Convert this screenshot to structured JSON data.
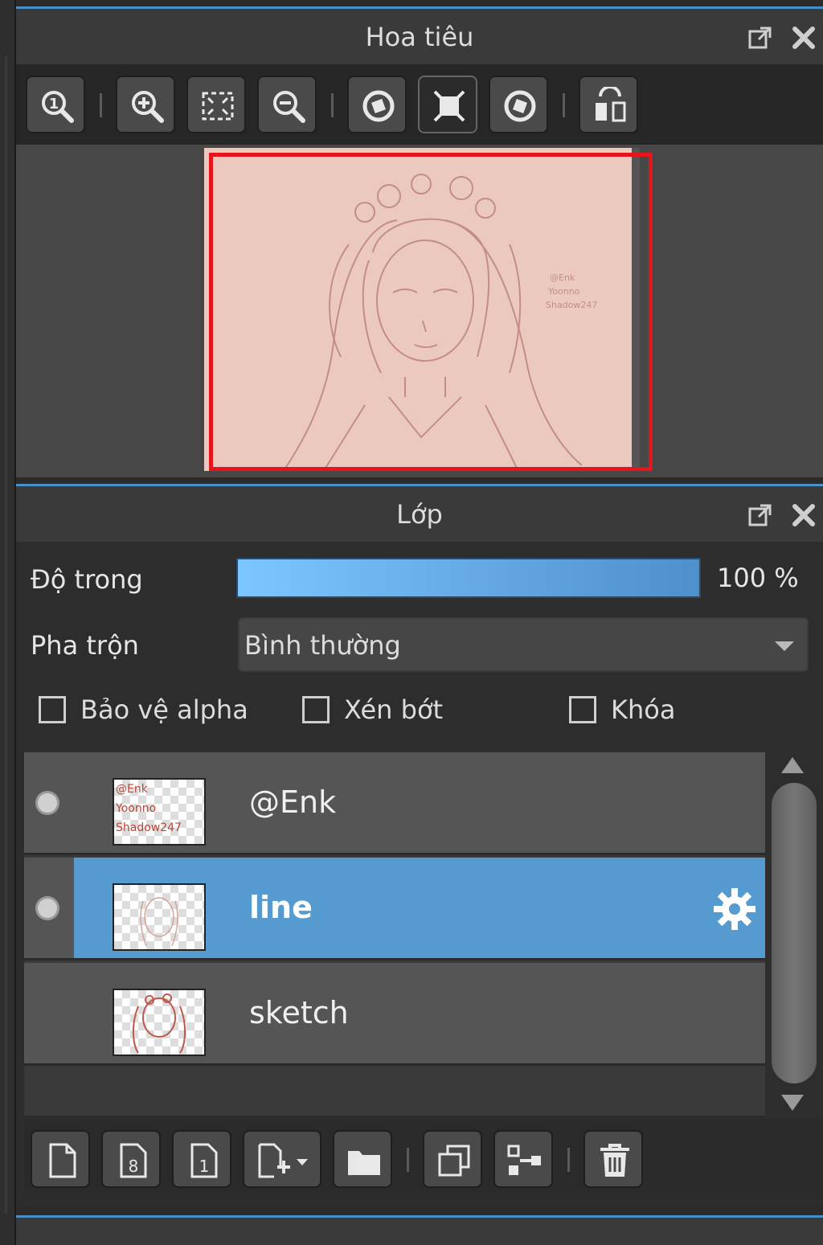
{
  "navigator": {
    "title": "Hoa tiêu",
    "toolbar": [
      "zoom-reset-icon",
      "zoom-in-icon",
      "fit-screen-icon",
      "zoom-out-icon",
      "rotate-left-icon",
      "fit-width-icon",
      "rotate-right-icon",
      "flip-icon"
    ]
  },
  "layers": {
    "title": "Lớp",
    "opacity_label": "Độ trong",
    "opacity_value": "100 %",
    "opacity_fraction": 1.0,
    "blend_label": "Pha trộn",
    "blend_value": "Bình thường",
    "checkboxes": [
      {
        "label": "Bảo vệ alpha",
        "checked": false
      },
      {
        "label": "Xén bớt",
        "checked": false
      },
      {
        "label": "Khóa",
        "checked": false
      }
    ],
    "items": [
      {
        "name": "@Enk",
        "visible": true,
        "selected": false
      },
      {
        "name": "line",
        "visible": true,
        "selected": true
      },
      {
        "name": "sketch",
        "visible": false,
        "selected": false
      }
    ]
  },
  "colors": {
    "accent": "#559bd0",
    "frame": "#e8141c",
    "canvas": "#ecc9bf"
  }
}
